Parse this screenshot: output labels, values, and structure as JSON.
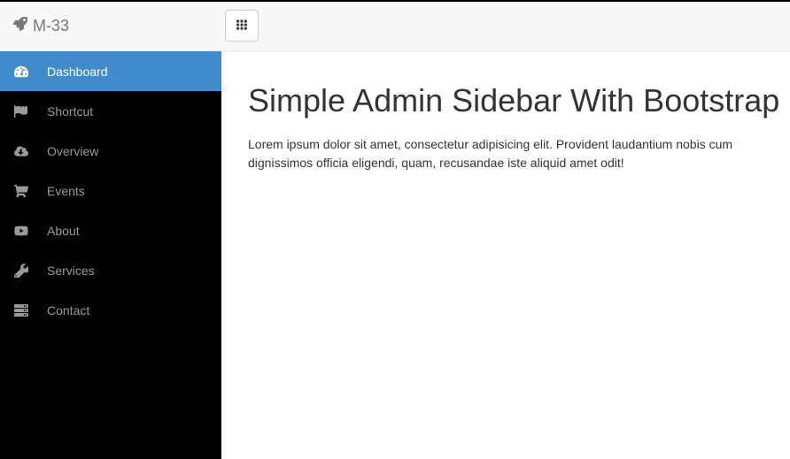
{
  "navbar": {
    "brand": "M-33"
  },
  "sidebar": {
    "items": [
      {
        "label": "Dashboard",
        "icon": "dashboard-icon",
        "active": true
      },
      {
        "label": "Shortcut",
        "icon": "flag-icon",
        "active": false
      },
      {
        "label": "Overview",
        "icon": "cloud-download-icon",
        "active": false
      },
      {
        "label": "Events",
        "icon": "cart-icon",
        "active": false
      },
      {
        "label": "About",
        "icon": "play-icon",
        "active": false
      },
      {
        "label": "Services",
        "icon": "wrench-icon",
        "active": false
      },
      {
        "label": "Contact",
        "icon": "server-icon",
        "active": false
      }
    ]
  },
  "main": {
    "heading": "Simple Admin Sidebar With Bootstrap",
    "paragraph": "Lorem ipsum dolor sit amet, consectetur adipisicing elit. Provident laudantium nobis cum dignissimos officia eligendi, quam, recusandae iste aliquid amet odit!"
  }
}
